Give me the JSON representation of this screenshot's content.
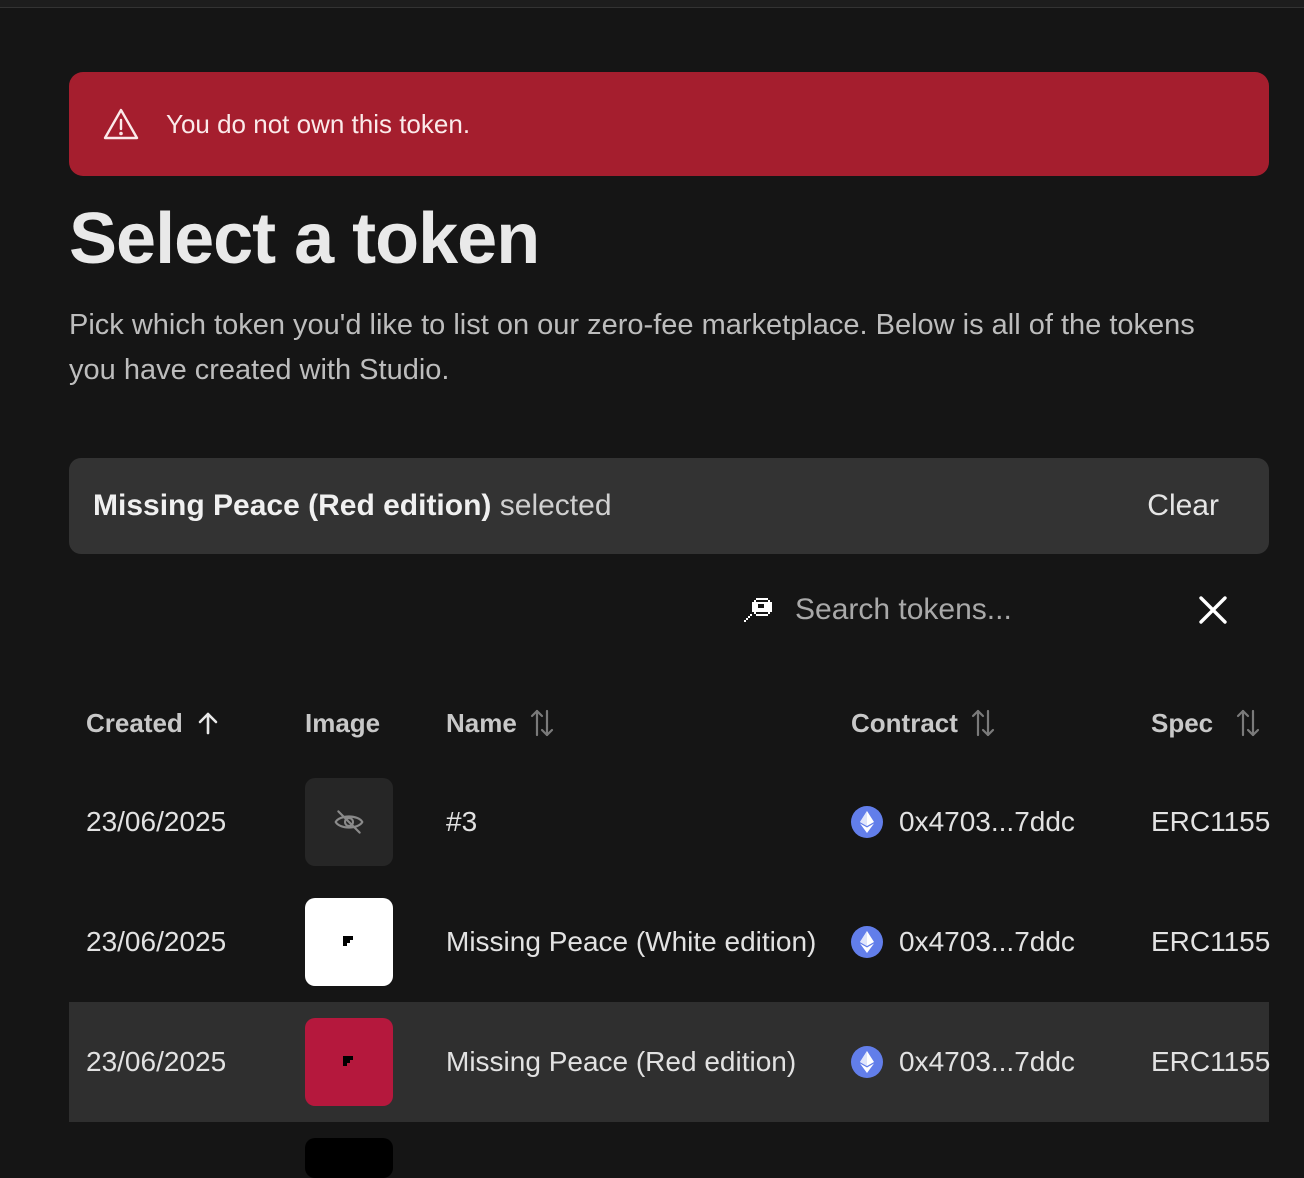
{
  "alert": {
    "text": "You do not own this token.",
    "color": "#a51e2e",
    "icon": "warning-triangle-icon"
  },
  "page": {
    "title": "Select a token",
    "subtitle": "Pick which token you'd like to list on our zero-fee marketplace. Below is all of the tokens you have created with Studio."
  },
  "selection": {
    "name": "Missing Peace (Red edition)",
    "suffix": "selected",
    "clear_label": "Clear"
  },
  "search": {
    "placeholder": "Search tokens...",
    "icon": "search-icon",
    "clear_icon": "close-icon"
  },
  "table": {
    "headers": {
      "created": "Created",
      "image": "Image",
      "name": "Name",
      "contract": "Contract",
      "spec": "Spec"
    },
    "sort": {
      "column": "created",
      "direction": "ascending"
    },
    "rows": [
      {
        "created": "23/06/2025",
        "image": "hidden",
        "name": "#3",
        "contract": "0x4703...7ddc",
        "chain_icon": "ethereum-icon",
        "spec": "ERC1155",
        "selected": false
      },
      {
        "created": "23/06/2025",
        "image": "white",
        "name": "Missing Peace (White edition)",
        "contract": "0x4703...7ddc",
        "chain_icon": "ethereum-icon",
        "spec": "ERC1155",
        "selected": false
      },
      {
        "created": "23/06/2025",
        "image": "red",
        "name": "Missing Peace (Red edition)",
        "contract": "0x4703...7ddc",
        "chain_icon": "ethereum-icon",
        "spec": "ERC1155",
        "selected": true
      }
    ]
  },
  "colors": {
    "background": "#151515",
    "selection_bar": "#333333",
    "selected_row": "#2f2f2f",
    "ethereum": "#627eea",
    "red_edition": "#b5183d"
  }
}
